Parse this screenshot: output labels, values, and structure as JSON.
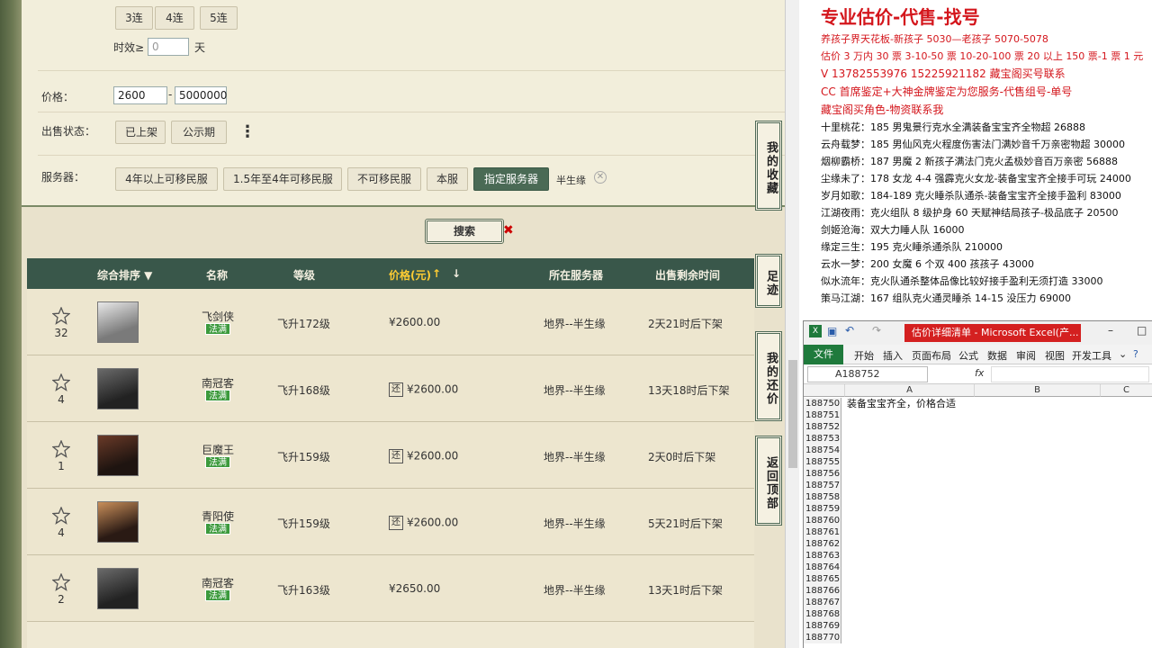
{
  "filter": {
    "lian_buttons": [
      "3连",
      "4连",
      "5连"
    ],
    "shixiao_label": "时效≥",
    "shixiao_placeholder": "0",
    "shixiao_unit": "天",
    "price_label": "价格：",
    "price_min": "2600",
    "price_sep": "-",
    "price_max": "5000000",
    "status_label": "出售状态：",
    "status_buttons": [
      "已上架",
      "公示期"
    ],
    "more_icon": "⋮",
    "server_label": "服务器：",
    "server_buttons": [
      "4年以上可移民服",
      "1.5年至4年可移民服",
      "不可移民服",
      "本服",
      "指定服务器"
    ],
    "server_selected": "半生缘",
    "search_label": "搜索"
  },
  "table": {
    "headers": [
      "综合排序 ▼",
      "名称",
      "等级",
      "价格(元)",
      "所在服务器",
      "出售剩余时间"
    ],
    "rows": [
      {
        "count": "32",
        "name": "飞剑侠",
        "badge": "法满",
        "level": "飞升172级",
        "bargain": false,
        "price": "¥2600.00",
        "server": "地界--半生缘",
        "time": "2天21时后下架"
      },
      {
        "count": "4",
        "name": "南冠客",
        "badge": "法满",
        "level": "飞升168级",
        "bargain": true,
        "price": "¥2600.00",
        "server": "地界--半生缘",
        "time": "13天18时后下架"
      },
      {
        "count": "1",
        "name": "巨魔王",
        "badge": "法满",
        "level": "飞升159级",
        "bargain": true,
        "price": "¥2600.00",
        "server": "地界--半生缘",
        "time": "2天0时后下架"
      },
      {
        "count": "4",
        "name": "青阳使",
        "badge": "法满",
        "level": "飞升159级",
        "bargain": true,
        "price": "¥2600.00",
        "server": "地界--半生缘",
        "time": "5天21时后下架"
      },
      {
        "count": "2",
        "name": "南冠客",
        "badge": "法满",
        "level": "飞升163级",
        "bargain": false,
        "price": "¥2650.00",
        "server": "地界--半生缘",
        "time": "13天1时后下架"
      }
    ],
    "bargain_icon": "还"
  },
  "side_buttons": [
    "我的收藏",
    "足迹",
    "我的还价",
    "返回顶部"
  ],
  "notes": {
    "title": "专业估价-代售-找号",
    "red_lines": [
      "养孩子界天花板-新孩子 5030—老孩子 5070-5078",
      "估价 3 万内 30 票  3-10-50 票  10-20-100 票  20 以上 150 票-1 票 1 元",
      "V 13782553976    15225921182   藏宝阁买号联系",
      "CC 首席鉴定+大神金牌鉴定为您服务-代售组号-单号",
      "藏宝阁买角色-物资联系我"
    ],
    "lines": [
      "十里桃花：185 男鬼景行克水全满装备宝宝齐全物超 26888",
      "云舟载梦：185 男仙风克火程度伤害法门满妙音千万亲密物超 30000",
      "烟柳霸桥：187 男魔 2 新孩子满法门克火孟极妙音百万亲密 56888",
      "尘缘未了：178 女龙 4-4 强霹克火女龙-装备宝宝齐全接手可玩 24000",
      "岁月如歌：184-189 克火睡杀队通杀-装备宝宝齐全接手盈利 83000",
      "江湖夜雨：克火组队 8 级护身 60 天赋神结局孩子-极品底子 20500",
      "剑姬沧海：双大力睡人队 16000",
      "缘定三生：195 克火睡杀通杀队 210000",
      "云水一梦：200 女魔 6 个双 400 孩孩子 43000",
      "似水流年：克火队通杀整体品像比较好接手盈利无须打造 33000",
      "策马江湖：167 组队克火通灵睡杀 14-15 没压力 69000"
    ]
  },
  "excel": {
    "title": "估价详细清单 - Microsoft Excel(产...",
    "tabs": [
      "文件",
      "开始",
      "插入",
      "页面布局",
      "公式",
      "数据",
      "审阅",
      "视图",
      "开发工具"
    ],
    "name_box": "A188752",
    "fx": "fx",
    "columns": [
      "A",
      "B",
      "C"
    ],
    "rows": [
      "188750",
      "188751",
      "188752",
      "188753",
      "188754",
      "188755",
      "188756",
      "188757",
      "188758",
      "188759",
      "188760",
      "188761",
      "188762",
      "188763",
      "188764",
      "188765",
      "188766",
      "188767",
      "188768",
      "188769",
      "188770"
    ],
    "cell_a1": "装备宝宝齐全，价格合适"
  }
}
